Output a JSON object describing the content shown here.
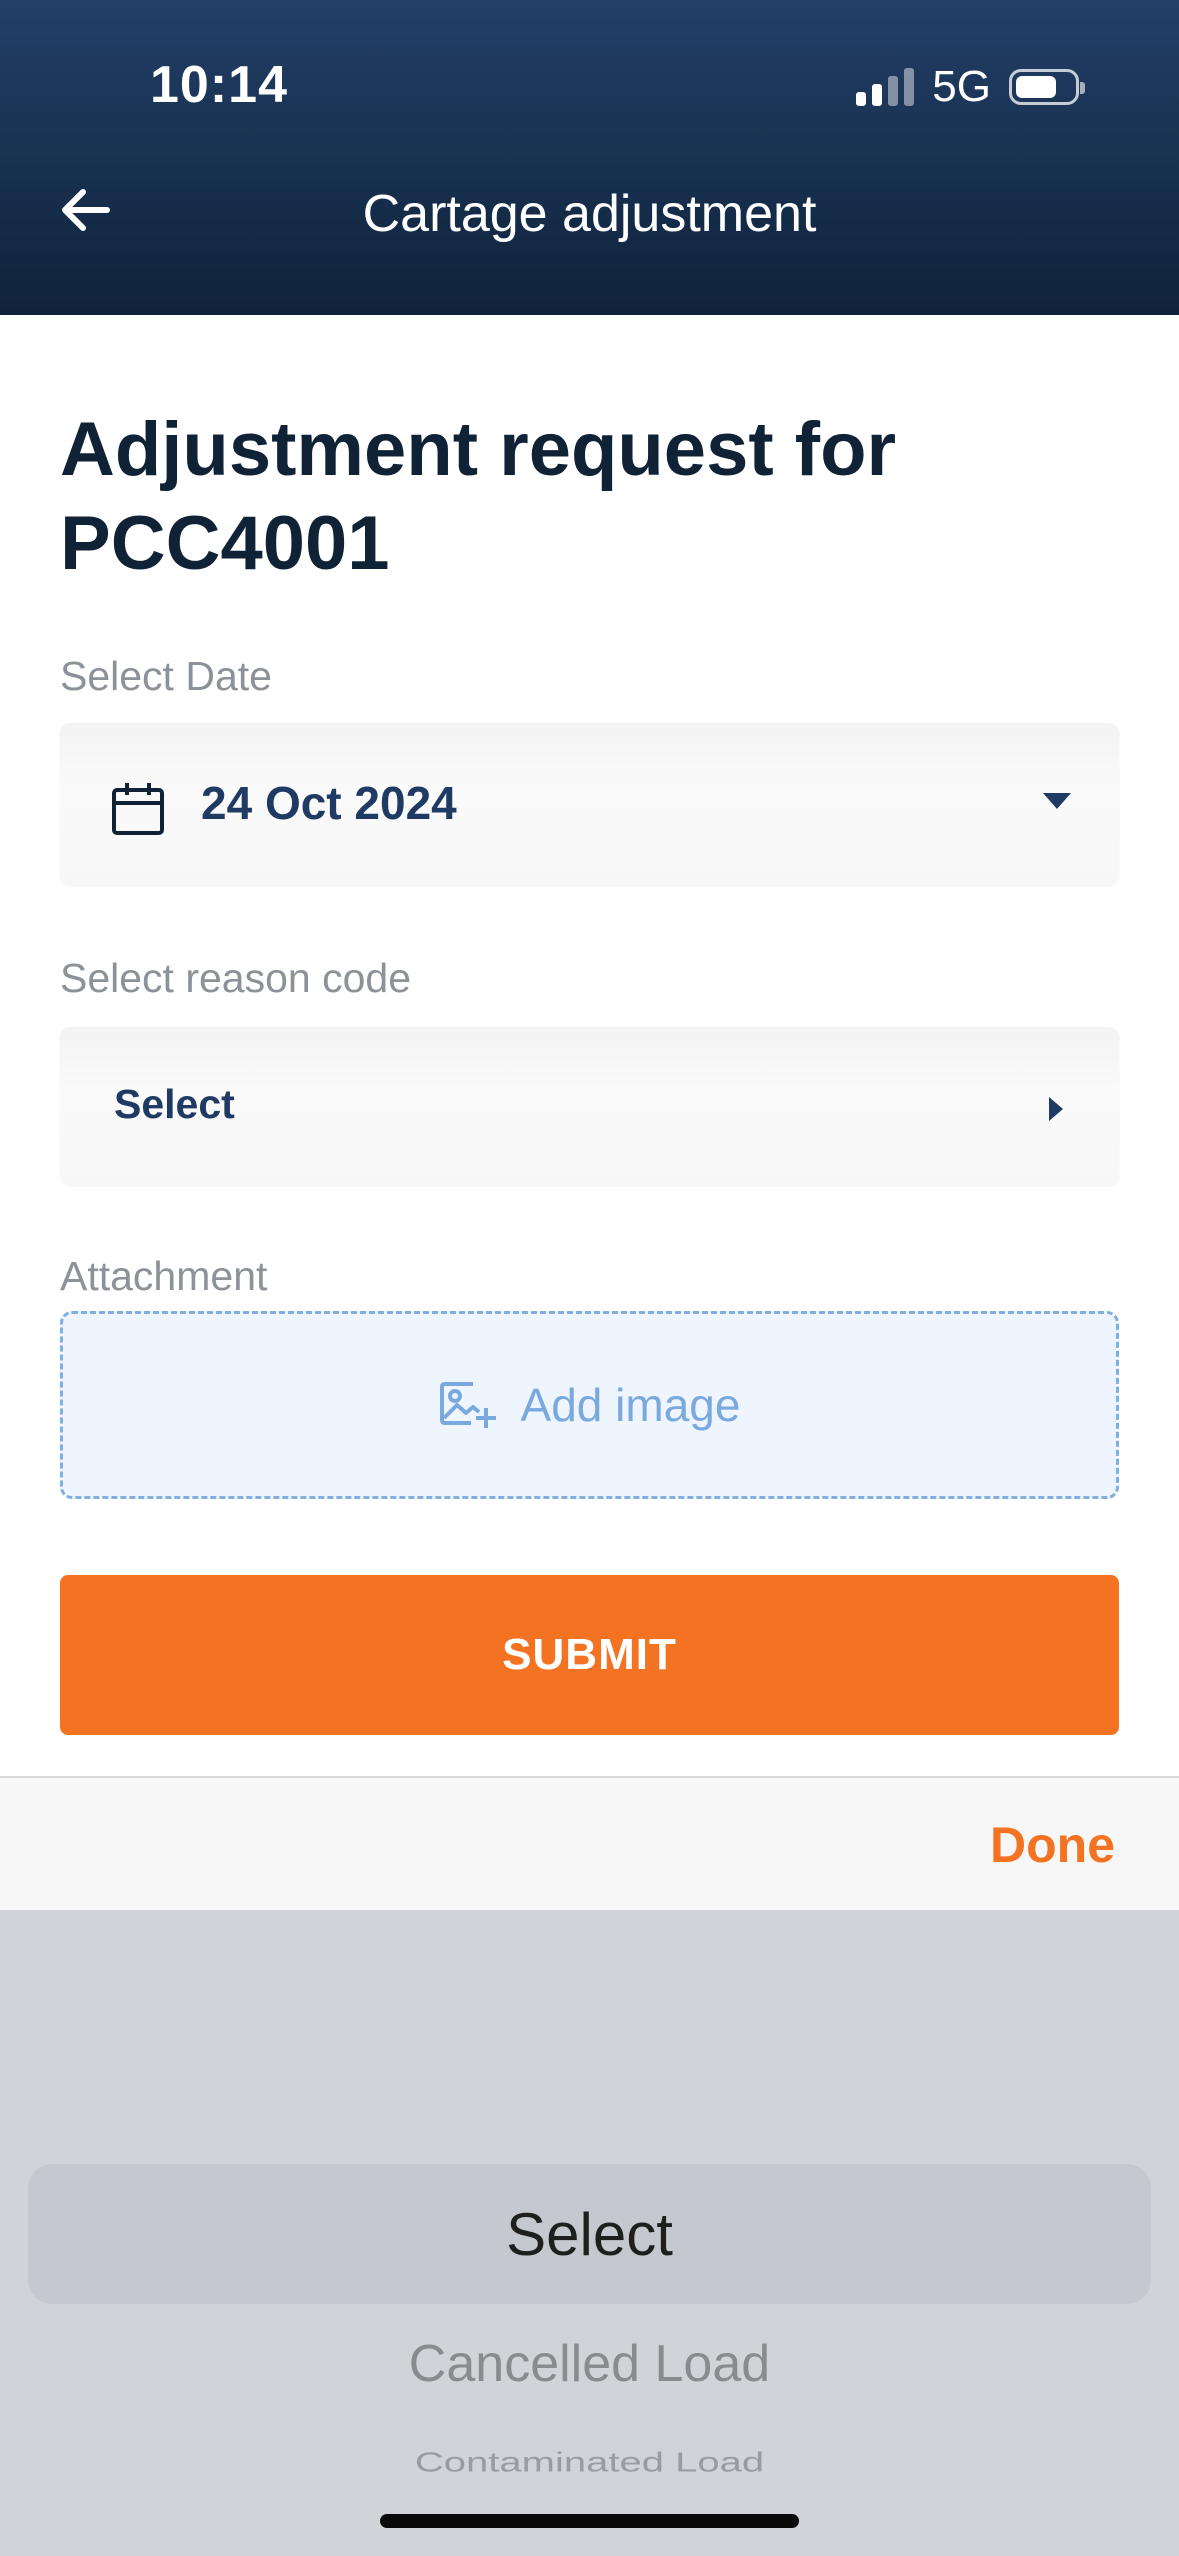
{
  "status_bar": {
    "time": "10:14",
    "network": "5G"
  },
  "nav": {
    "title": "Cartage adjustment"
  },
  "main": {
    "heading": "Adjustment request for PCC4001",
    "date_label": "Select Date",
    "date_value": "24 Oct 2024",
    "reason_label": "Select reason code",
    "reason_value": "Select",
    "attachment_label": "Attachment",
    "add_image_label": "Add image",
    "submit_label": "SUBMIT"
  },
  "picker": {
    "done_label": "Done",
    "options": [
      "Select",
      "Cancelled Load",
      "Contaminated Load",
      ""
    ],
    "selected_index": 0
  },
  "colors": {
    "accent": "#f47322",
    "header": "#17304f",
    "field_text": "#1f3a63",
    "attachment": "#7aa9df"
  }
}
